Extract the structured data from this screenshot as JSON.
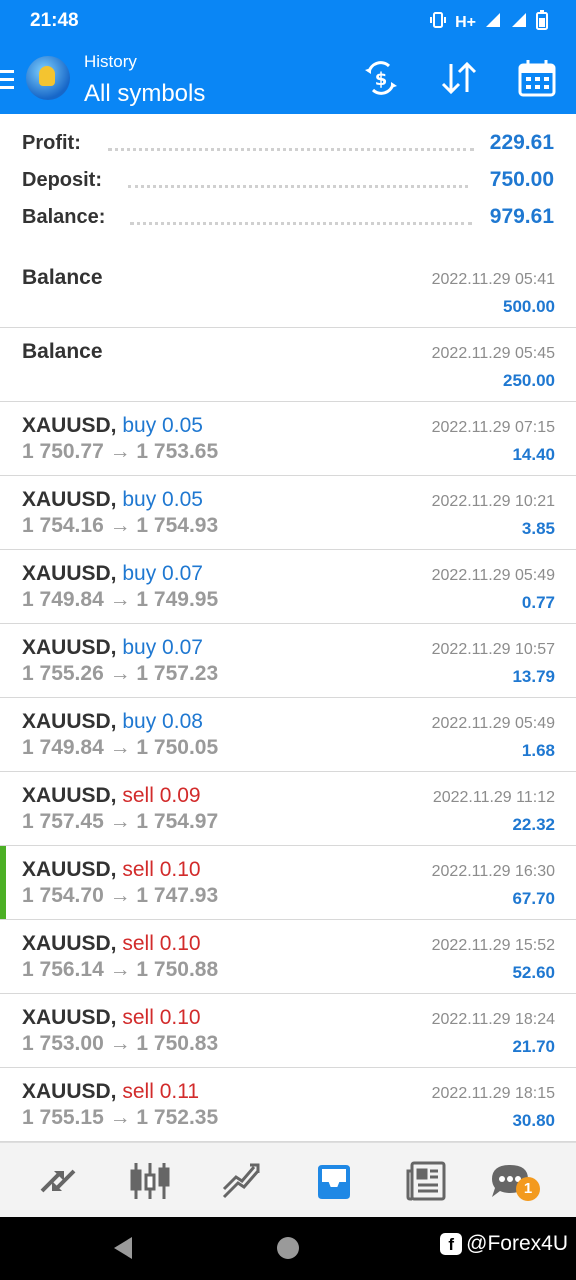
{
  "status_bar": {
    "time": "21:48",
    "network": "H+"
  },
  "app_bar": {
    "section": "History",
    "filter": "All symbols"
  },
  "summary": [
    {
      "label": "Profit:",
      "value": "229.61"
    },
    {
      "label": "Deposit:",
      "value": "750.00"
    },
    {
      "label": "Balance:",
      "value": "979.61"
    }
  ],
  "history": [
    {
      "title": "Balance",
      "type": "balance",
      "datetime": "2022.11.29 05:41",
      "amount": "500.00"
    },
    {
      "title": "Balance",
      "type": "balance",
      "datetime": "2022.11.29 05:45",
      "amount": "250.00"
    },
    {
      "symbol": "XAUUSD,",
      "side": "buy",
      "volume": "buy 0.05",
      "prices": "1 750.77 → 1 753.65",
      "datetime": "2022.11.29 07:15",
      "amount": "14.40"
    },
    {
      "symbol": "XAUUSD,",
      "side": "buy",
      "volume": "buy 0.05",
      "prices": "1 754.16 → 1 754.93",
      "datetime": "2022.11.29 10:21",
      "amount": "3.85"
    },
    {
      "symbol": "XAUUSD,",
      "side": "buy",
      "volume": "buy 0.07",
      "prices": "1 749.84 → 1 749.95",
      "datetime": "2022.11.29 05:49",
      "amount": "0.77"
    },
    {
      "symbol": "XAUUSD,",
      "side": "buy",
      "volume": "buy 0.07",
      "prices": "1 755.26 → 1 757.23",
      "datetime": "2022.11.29 10:57",
      "amount": "13.79"
    },
    {
      "symbol": "XAUUSD,",
      "side": "buy",
      "volume": "buy 0.08",
      "prices": "1 749.84 → 1 750.05",
      "datetime": "2022.11.29 05:49",
      "amount": "1.68"
    },
    {
      "symbol": "XAUUSD,",
      "side": "sell",
      "volume": "sell 0.09",
      "prices": "1 757.45 → 1 754.97",
      "datetime": "2022.11.29 11:12",
      "amount": "22.32"
    },
    {
      "symbol": "XAUUSD,",
      "side": "sell",
      "volume": "sell 0.10",
      "prices": "1 754.70 → 1 747.93",
      "datetime": "2022.11.29 16:30",
      "amount": "67.70",
      "selected": true
    },
    {
      "symbol": "XAUUSD,",
      "side": "sell",
      "volume": "sell 0.10",
      "prices": "1 756.14 → 1 750.88",
      "datetime": "2022.11.29 15:52",
      "amount": "52.60"
    },
    {
      "symbol": "XAUUSD,",
      "side": "sell",
      "volume": "sell 0.10",
      "prices": "1 753.00 → 1 750.83",
      "datetime": "2022.11.29 18:24",
      "amount": "21.70"
    },
    {
      "symbol": "XAUUSD,",
      "side": "sell",
      "volume": "sell 0.11",
      "prices": "1 755.15 → 1 752.35",
      "datetime": "2022.11.29 18:15",
      "amount": "30.80"
    }
  ],
  "bottom_nav": {
    "items": [
      "quotes-icon",
      "chart-icon",
      "trade-icon",
      "history-icon",
      "news-icon",
      "messages-icon"
    ],
    "active": "history-icon",
    "messages_badge": "1"
  },
  "watermark": {
    "fb_letter": "f",
    "text": "@Forex4U"
  },
  "colors": {
    "accent": "#0a86f5",
    "buy": "#1f78d1",
    "sell": "#d22b2b",
    "selected_marker": "#4caf25",
    "badge": "#f39a1e"
  }
}
